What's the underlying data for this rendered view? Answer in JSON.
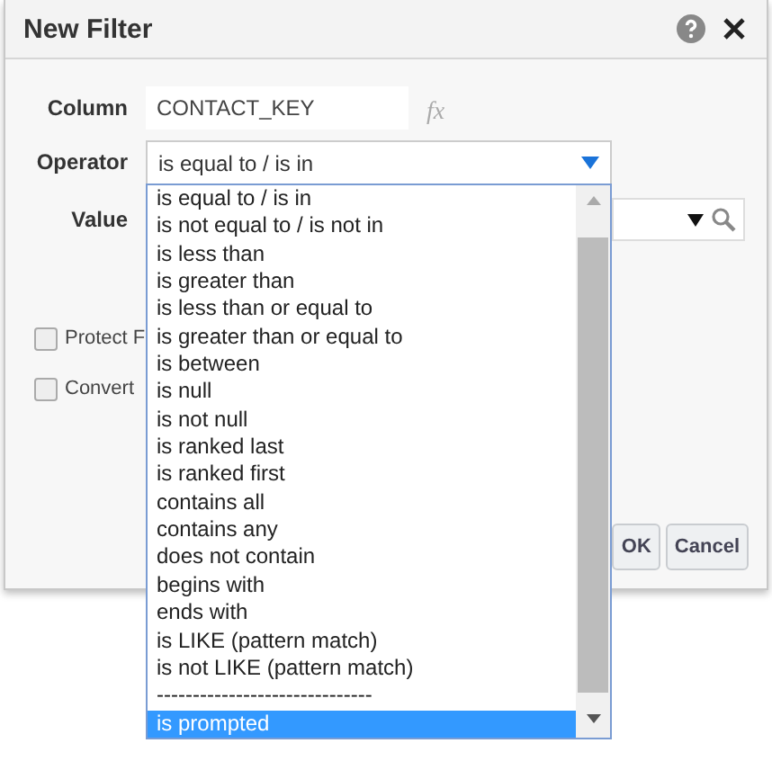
{
  "dialog": {
    "title": "New Filter"
  },
  "column": {
    "label": "Column",
    "value": "CONTACT_KEY",
    "function_label": "fx"
  },
  "operator": {
    "label": "Operator",
    "value": "is equal to / is in"
  },
  "value": {
    "label": "Value"
  },
  "checkboxes": [
    {
      "label": "Protect F",
      "checked": false
    },
    {
      "label": "Convert",
      "checked": false
    }
  ],
  "buttons": [
    "OK",
    "Cancel"
  ],
  "operator_list": [
    {
      "label": "is equal to / is in",
      "selected": false
    },
    {
      "label": "is not equal to / is not in",
      "selected": false
    },
    {
      "label": "is less than",
      "selected": false
    },
    {
      "label": "is greater than",
      "selected": false
    },
    {
      "label": "is less than or equal to",
      "selected": false
    },
    {
      "label": "is greater than or equal to",
      "selected": false
    },
    {
      "label": "is between",
      "selected": false
    },
    {
      "label": "is null",
      "selected": false
    },
    {
      "label": "is not null",
      "selected": false
    },
    {
      "label": "is ranked last",
      "selected": false
    },
    {
      "label": "is ranked first",
      "selected": false
    },
    {
      "label": "contains all",
      "selected": false
    },
    {
      "label": "contains any",
      "selected": false
    },
    {
      "label": "does not contain",
      "selected": false
    },
    {
      "label": "begins with",
      "selected": false
    },
    {
      "label": "ends with",
      "selected": false
    },
    {
      "label": "is LIKE (pattern match)",
      "selected": false
    },
    {
      "label": "is not LIKE (pattern match)",
      "selected": false
    },
    {
      "label": "------------------------------",
      "selected": false
    },
    {
      "label": "is prompted",
      "selected": true
    }
  ]
}
